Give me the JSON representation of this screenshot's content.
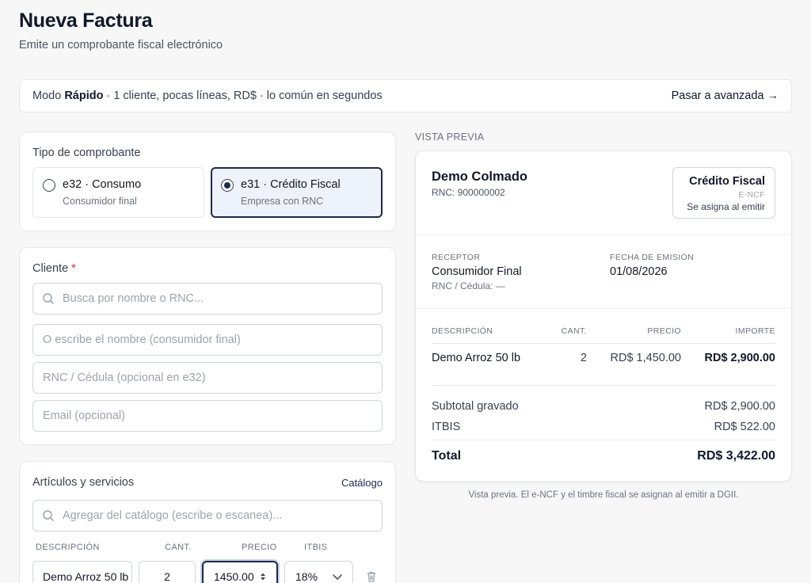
{
  "page": {
    "title": "Nueva Factura",
    "subtitle": "Emite un comprobante fiscal electrónico"
  },
  "mode_bar": {
    "prefix": "Modo",
    "mode": "Rápido",
    "description": "· 1 cliente, pocas líneas, RD$ · lo común en segundos",
    "link": "Pasar a avanzada →"
  },
  "tipo": {
    "label": "Tipo de comprobante",
    "options": [
      {
        "title": "e32 · Consumo",
        "subtitle": "Consumidor final",
        "selected": false
      },
      {
        "title": "e31 · Crédito Fiscal",
        "subtitle": "Empresa con RNC",
        "selected": true
      }
    ]
  },
  "cliente": {
    "label": "Cliente",
    "required_mark": "*",
    "search_placeholder": "Busca por nombre o RNC...",
    "name_placeholder": "O escribe el nombre (consumidor final)",
    "rnc_placeholder": "RNC / Cédula (opcional en e32)",
    "email_placeholder": "Email (opcional)"
  },
  "articulos": {
    "label": "Artículos y servicios",
    "catalog_link": "Catálogo",
    "search_placeholder": "Agregar del catálogo (escribe o escanea)...",
    "columns": [
      "DESCRIPCIÓN",
      "CANT.",
      "PRECIO",
      "ITBIS"
    ],
    "line": {
      "description": "Demo Arroz 50 lb",
      "quantity": "2",
      "price": "1450.00",
      "itbis": "18%"
    }
  },
  "preview": {
    "section_label": "VISTA PREVIA",
    "company": "Demo Colmado",
    "company_rnc": "RNC: 900000002",
    "doc_type": "Crédito Fiscal",
    "encf_label": "E-NCF",
    "encf_value": "Se asigna al emitir",
    "receptor_label": "RECEPTOR",
    "receptor_name": "Consumidor Final",
    "receptor_id": "RNC / Cédula: —",
    "fecha_label": "FECHA DE EMISIÓN",
    "fecha_value": "01/08/2026",
    "table_headers": [
      "DESCRIPCIÓN",
      "CANT.",
      "PRECIO",
      "IMPORTE"
    ],
    "items": [
      {
        "description": "Demo Arroz 50 lb",
        "quantity": "2",
        "price": "RD$ 1,450.00",
        "amount": "RD$ 2,900.00"
      }
    ],
    "subtotal_label": "Subtotal gravado",
    "subtotal_value": "RD$ 2,900.00",
    "itbis_label": "ITBIS",
    "itbis_value": "RD$ 522.00",
    "total_label": "Total",
    "total_value": "RD$ 3,422.00",
    "footnote": "Vista previa. El e-NCF y el timbre fiscal se asignan al emitir a DGII."
  },
  "colors": {
    "accent": "#1e2a4a",
    "required": "#dc2626",
    "border": "#e5e7eb"
  },
  "icons": {
    "search": "search-icon",
    "chevron": "chevron-down-icon",
    "delete": "trash-icon",
    "spinner": "stepper-arrows-icon"
  }
}
